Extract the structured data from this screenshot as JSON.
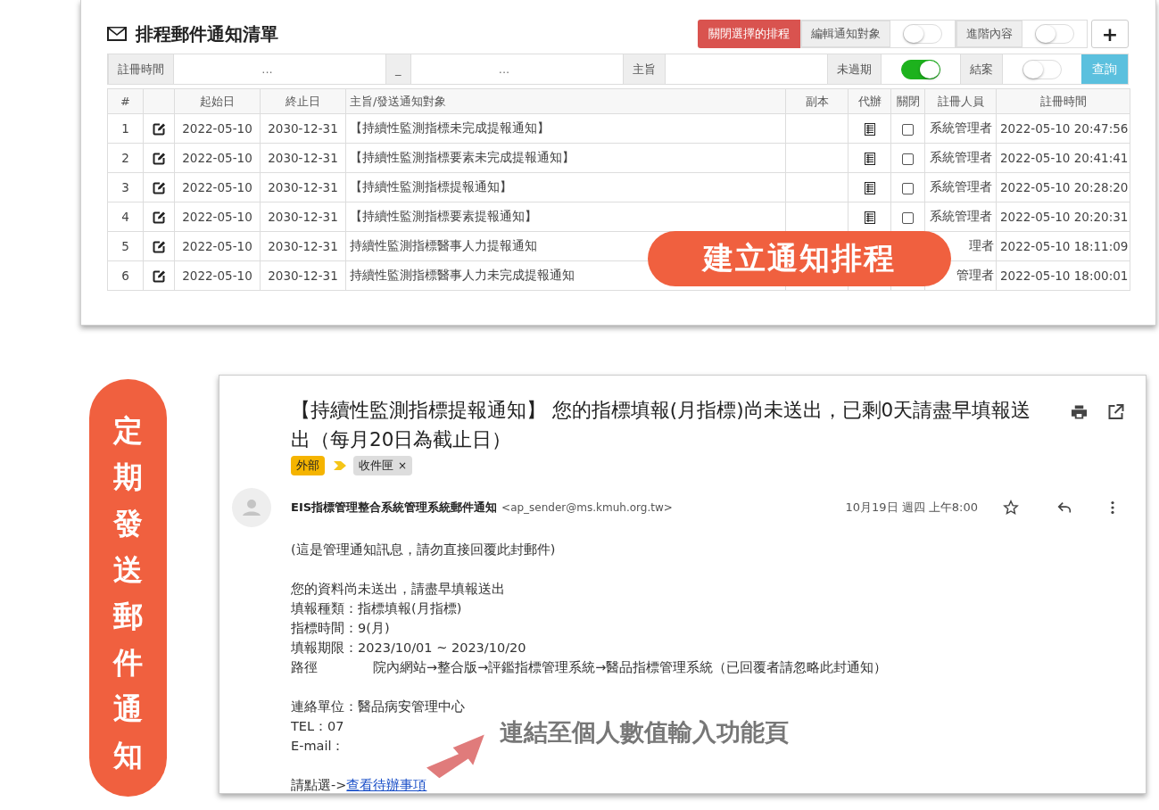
{
  "schedule_panel": {
    "title": "排程郵件通知清單",
    "toolbar": [
      {
        "kind": "danger-button",
        "label": "關閉選擇的排程"
      },
      {
        "kind": "toggle",
        "label": "編輯通知對象",
        "on": false
      },
      {
        "kind": "toggle",
        "label": "進階內容",
        "on": false
      },
      {
        "kind": "icon-button",
        "label": "+"
      }
    ],
    "filters": [
      {
        "kind": "addon",
        "label": "註冊時間"
      },
      {
        "kind": "input",
        "placeholder": "..."
      },
      {
        "kind": "addon",
        "label": "_"
      },
      {
        "kind": "input",
        "placeholder": "..."
      },
      {
        "kind": "addon",
        "label": "主旨"
      },
      {
        "kind": "input"
      },
      {
        "kind": "toggle",
        "label": "未過期",
        "on": true
      },
      {
        "kind": "toggle",
        "label": "結案",
        "on": false
      },
      {
        "kind": "button",
        "label": "查詢"
      }
    ],
    "columns": [
      "#",
      "起始日",
      "終止日",
      "主旨/發送通知對象",
      "副本",
      "代辦",
      "關閉",
      "註冊人員",
      "註冊時間"
    ],
    "rows": [
      {
        "no": "1",
        "start": "2022-05-10",
        "end": "2030-12-31",
        "subject": "【持續性監測指標未完成提報通知】",
        "closed": false,
        "registrant": "系統管理者",
        "time": "2022-05-10 20:47:56"
      },
      {
        "no": "2",
        "start": "2022-05-10",
        "end": "2030-12-31",
        "subject": "【持續性監測指標要素未完成提報通知】",
        "closed": false,
        "registrant": "系統管理者",
        "time": "2022-05-10 20:41:41"
      },
      {
        "no": "3",
        "start": "2022-05-10",
        "end": "2030-12-31",
        "subject": "【持續性監測指標提報通知】",
        "closed": false,
        "registrant": "系統管理者",
        "time": "2022-05-10 20:28:20"
      },
      {
        "no": "4",
        "start": "2022-05-10",
        "end": "2030-12-31",
        "subject": "【持續性監測指標要素提報通知】",
        "closed": false,
        "registrant": "系統管理者",
        "time": "2022-05-10 20:20:31"
      },
      {
        "no": "5",
        "start": "2022-05-10",
        "end": "2030-12-31",
        "subject": "持續性監測指標醫事人力提報通知",
        "registrant": "理者",
        "time": "2022-05-10 18:11:09"
      },
      {
        "no": "6",
        "start": "2022-05-10",
        "end": "2030-12-31",
        "subject": "持續性監測指標醫事人力未完成提報通知",
        "registrant": "管理者",
        "time": "2022-05-10 18:00:01"
      }
    ]
  },
  "callout_schedule": "建立通知排程",
  "callout_side": "定期發送郵件通知",
  "email": {
    "subject": "【持續性監測指標提報通知】 您的指標填報(月指標)尚未送出，已剩0天請盡早填報送出（每月20日為截止日）",
    "tags": [
      {
        "label": "外部",
        "color": "#f5b400",
        "removable": false
      },
      {
        "label": "收件匣",
        "color": "#dddddd",
        "removable": true
      }
    ],
    "remove_mark": "×",
    "sender": "EIS指標管理整合系統管理系統郵件通知",
    "address": "<ap_sender@ms.kmuh.org.tw>",
    "date": "10月19日 週四 上午8:00",
    "body": [
      [
        {
          "kind": "text",
          "text": "(這是管理通知訊息，請勿直接回覆此封郵件)"
        }
      ],
      [
        {
          "kind": "text",
          "text": "您的資料尚未送出，請盡早填報送出"
        },
        {
          "kind": "text",
          "text": "填報種類：指標填報(月指標)"
        },
        {
          "kind": "text",
          "text": "指標時間：9(月)"
        },
        {
          "kind": "text",
          "text": "填報期限：2023/10/01 ~ 2023/10/20"
        },
        {
          "kind": "split",
          "label": "路徑",
          "text": "院內網站→整合版→評鑑指標管理系統→醫品指標管理系統（已回覆者請忽略此封通知）"
        }
      ],
      [
        {
          "kind": "text",
          "text": "連絡單位：醫品病安管理中心"
        },
        {
          "kind": "text",
          "text": "TEL：07"
        },
        {
          "kind": "text",
          "text": "E-mail："
        }
      ],
      [
        {
          "kind": "link",
          "label": "請點選->",
          "text": "查看待辦事項"
        }
      ]
    ]
  },
  "callout_link": "連結至個人數值輸入功能頁"
}
